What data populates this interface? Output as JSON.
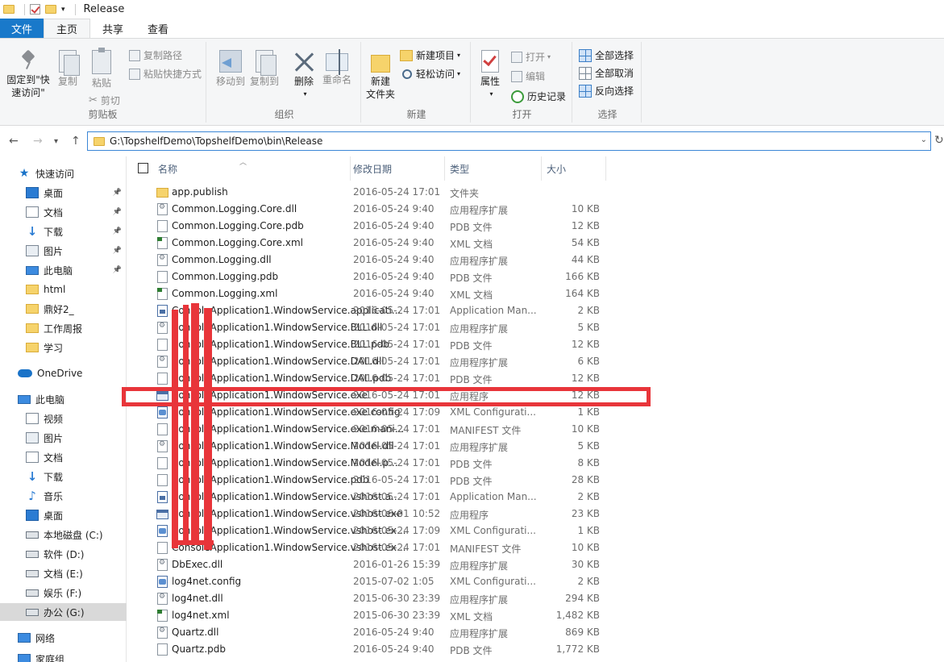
{
  "window": {
    "title": "Release"
  },
  "tabs": [
    {
      "label": "文件"
    },
    {
      "label": "主页"
    },
    {
      "label": "共享"
    },
    {
      "label": "查看"
    }
  ],
  "ribbon": {
    "clipboard": {
      "group_label": "剪贴板",
      "pin_label_1": "固定到\"快",
      "pin_label_2": "速访问\"",
      "copy": "复制",
      "paste": "粘贴",
      "copy_path": "复制路径",
      "paste_shortcut": "粘贴快捷方式",
      "cut": "剪切"
    },
    "organize": {
      "group_label": "组织",
      "move_to": "移动到",
      "copy_to": "复制到",
      "delete": "删除",
      "rename": "重命名"
    },
    "new": {
      "group_label": "新建",
      "new_folder_1": "新建",
      "new_folder_2": "文件夹",
      "new_item": "新建项目",
      "easy_access": "轻松访问"
    },
    "open": {
      "group_label": "打开",
      "properties": "属性",
      "open": "打开",
      "edit": "编辑",
      "history": "历史记录"
    },
    "select": {
      "group_label": "选择",
      "select_all": "全部选择",
      "select_none": "全部取消",
      "invert": "反向选择"
    }
  },
  "address": {
    "path": "G:\\TopshelfDemo\\TopshelfDemo\\bin\\Release"
  },
  "nav": [
    {
      "label": "快速访问",
      "icon": "star-icon"
    },
    {
      "label": "桌面",
      "icon": "desktop-icon",
      "pinned": true
    },
    {
      "label": "文档",
      "icon": "document-icon",
      "pinned": true
    },
    {
      "label": "下载",
      "icon": "download-icon",
      "pinned": true
    },
    {
      "label": "图片",
      "icon": "pictures-icon",
      "pinned": true
    },
    {
      "label": "此电脑",
      "icon": "computer-icon",
      "pinned": true
    },
    {
      "label": "html",
      "icon": "folder-icon"
    },
    {
      "label": "鼎好2_",
      "icon": "folder-icon"
    },
    {
      "label": "工作周报",
      "icon": "folder-icon"
    },
    {
      "label": "学习",
      "icon": "folder-icon"
    },
    {
      "label": "OneDrive",
      "icon": "cloud-icon"
    },
    {
      "label": "此电脑",
      "icon": "computer-icon"
    },
    {
      "label": "视频",
      "icon": "video-icon"
    },
    {
      "label": "图片",
      "icon": "pictures-icon"
    },
    {
      "label": "文档",
      "icon": "document-icon"
    },
    {
      "label": "下载",
      "icon": "download-icon"
    },
    {
      "label": "音乐",
      "icon": "music-icon"
    },
    {
      "label": "桌面",
      "icon": "desktop-icon"
    },
    {
      "label": "本地磁盘 (C:)",
      "icon": "drive-icon"
    },
    {
      "label": "软件 (D:)",
      "icon": "drive-icon"
    },
    {
      "label": "文档 (E:)",
      "icon": "drive-icon"
    },
    {
      "label": "娱乐 (F:)",
      "icon": "drive-icon"
    },
    {
      "label": "办公 (G:)",
      "icon": "drive-icon"
    },
    {
      "label": "网络",
      "icon": "network-icon"
    },
    {
      "label": "家庭组",
      "icon": "homegroup-icon"
    }
  ],
  "columns": {
    "name": "名称",
    "date": "修改日期",
    "type": "类型",
    "size": "大小"
  },
  "files": [
    {
      "name": "app.publish",
      "date": "2016-05-24 17:01",
      "type": "文件夹",
      "size": "",
      "kind": "folder"
    },
    {
      "name": "Common.Logging.Core.dll",
      "date": "2016-05-24 9:40",
      "type": "应用程序扩展",
      "size": "10 KB",
      "kind": "dll"
    },
    {
      "name": "Common.Logging.Core.pdb",
      "date": "2016-05-24 9:40",
      "type": "PDB 文件",
      "size": "12 KB",
      "kind": "pdb"
    },
    {
      "name": "Common.Logging.Core.xml",
      "date": "2016-05-24 9:40",
      "type": "XML 文档",
      "size": "54 KB",
      "kind": "xml"
    },
    {
      "name": "Common.Logging.dll",
      "date": "2016-05-24 9:40",
      "type": "应用程序扩展",
      "size": "44 KB",
      "kind": "dll"
    },
    {
      "name": "Common.Logging.pdb",
      "date": "2016-05-24 9:40",
      "type": "PDB 文件",
      "size": "166 KB",
      "kind": "pdb"
    },
    {
      "name": "Common.Logging.xml",
      "date": "2016-05-24 9:40",
      "type": "XML 文档",
      "size": "164 KB",
      "kind": "xml"
    },
    {
      "name": "ConsoleApplication1.WindowService.applicati...",
      "date": "2016-05-24 17:01",
      "type": "Application Man...",
      "size": "2 KB",
      "kind": "app"
    },
    {
      "name": "ConsoleApplication1.WindowService.BLL.dll",
      "date": "2016-05-24 17:01",
      "type": "应用程序扩展",
      "size": "5 KB",
      "kind": "dll"
    },
    {
      "name": "ConsoleApplication1.WindowService.BLL.pdb",
      "date": "2016-05-24 17:01",
      "type": "PDB 文件",
      "size": "12 KB",
      "kind": "pdb"
    },
    {
      "name": "ConsoleApplication1.WindowService.DAL.dll",
      "date": "2016-05-24 17:01",
      "type": "应用程序扩展",
      "size": "6 KB",
      "kind": "dll"
    },
    {
      "name": "ConsoleApplication1.WindowService.DAL.pdb",
      "date": "2016-05-24 17:01",
      "type": "PDB 文件",
      "size": "12 KB",
      "kind": "pdb"
    },
    {
      "name": "ConsoleApplication1.WindowService.exe",
      "date": "2016-05-24 17:01",
      "type": "应用程序",
      "size": "12 KB",
      "kind": "exe"
    },
    {
      "name": "ConsoleApplication1.WindowService.exe.config",
      "date": "2016-05-24 17:09",
      "type": "XML Configurati...",
      "size": "1 KB",
      "kind": "config"
    },
    {
      "name": "ConsoleApplication1.WindowService.exe.mani...",
      "date": "2016-05-24 17:01",
      "type": "MANIFEST 文件",
      "size": "10 KB",
      "kind": "pdb"
    },
    {
      "name": "ConsoleApplication1.WindowService.Model.dll",
      "date": "2016-05-24 17:01",
      "type": "应用程序扩展",
      "size": "5 KB",
      "kind": "dll"
    },
    {
      "name": "ConsoleApplication1.WindowService.Model.p...",
      "date": "2016-05-24 17:01",
      "type": "PDB 文件",
      "size": "8 KB",
      "kind": "pdb"
    },
    {
      "name": "ConsoleApplication1.WindowService.pdb",
      "date": "2016-05-24 17:01",
      "type": "PDB 文件",
      "size": "28 KB",
      "kind": "pdb"
    },
    {
      "name": "ConsoleApplication1.WindowService.vshost.a...",
      "date": "2016-05-24 17:01",
      "type": "Application Man...",
      "size": "2 KB",
      "kind": "app"
    },
    {
      "name": "ConsoleApplication1.WindowService.vshost.exe",
      "date": "2016-06-01 10:52",
      "type": "应用程序",
      "size": "23 KB",
      "kind": "exe"
    },
    {
      "name": "ConsoleApplication1.WindowService.vshost.ex...",
      "date": "2016-05-24 17:09",
      "type": "XML Configurati...",
      "size": "1 KB",
      "kind": "config"
    },
    {
      "name": "ConsoleApplication1.WindowService.vshost.ex...",
      "date": "2016-05-24 17:01",
      "type": "MANIFEST 文件",
      "size": "10 KB",
      "kind": "pdb"
    },
    {
      "name": "DbExec.dll",
      "date": "2016-01-26 15:39",
      "type": "应用程序扩展",
      "size": "30 KB",
      "kind": "dll"
    },
    {
      "name": "log4net.config",
      "date": "2015-07-02 1:05",
      "type": "XML Configurati...",
      "size": "2 KB",
      "kind": "config"
    },
    {
      "name": "log4net.dll",
      "date": "2015-06-30 23:39",
      "type": "应用程序扩展",
      "size": "294 KB",
      "kind": "dll"
    },
    {
      "name": "log4net.xml",
      "date": "2015-06-30 23:39",
      "type": "XML 文档",
      "size": "1,482 KB",
      "kind": "xml"
    },
    {
      "name": "Quartz.dll",
      "date": "2016-05-24 9:40",
      "type": "应用程序扩展",
      "size": "869 KB",
      "kind": "dll"
    },
    {
      "name": "Quartz.pdb",
      "date": "2016-05-24 9:40",
      "type": "PDB 文件",
      "size": "1,772 KB",
      "kind": "pdb"
    }
  ]
}
